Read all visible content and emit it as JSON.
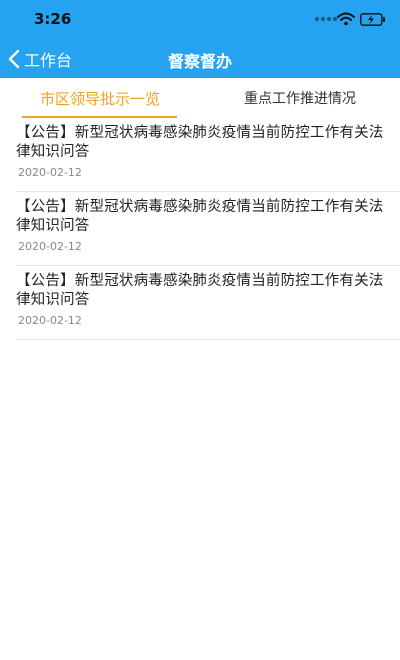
{
  "status_bar": {
    "time": "3:26",
    "icons": [
      "signal-dots-icon",
      "wifi-icon",
      "battery-charging-icon"
    ]
  },
  "nav": {
    "back_label": "工作台",
    "back_icon": "chevron-left-icon",
    "title": "督察督办"
  },
  "colors": {
    "primary": "#26a3f0",
    "accent": "#f0a31f"
  },
  "tabs": [
    {
      "label": "市区领导批示一览",
      "active": true
    },
    {
      "label": "重点工作推进情况",
      "active": false
    }
  ],
  "items": [
    {
      "title": "【公告】新型冠状病毒感染肺炎疫情当前防控工作有关法律知识问答",
      "date": "2020-02-12"
    },
    {
      "title": "【公告】新型冠状病毒感染肺炎疫情当前防控工作有关法律知识问答",
      "date": "2020-02-12"
    },
    {
      "title": "【公告】新型冠状病毒感染肺炎疫情当前防控工作有关法律知识问答",
      "date": "2020-02-12"
    }
  ]
}
